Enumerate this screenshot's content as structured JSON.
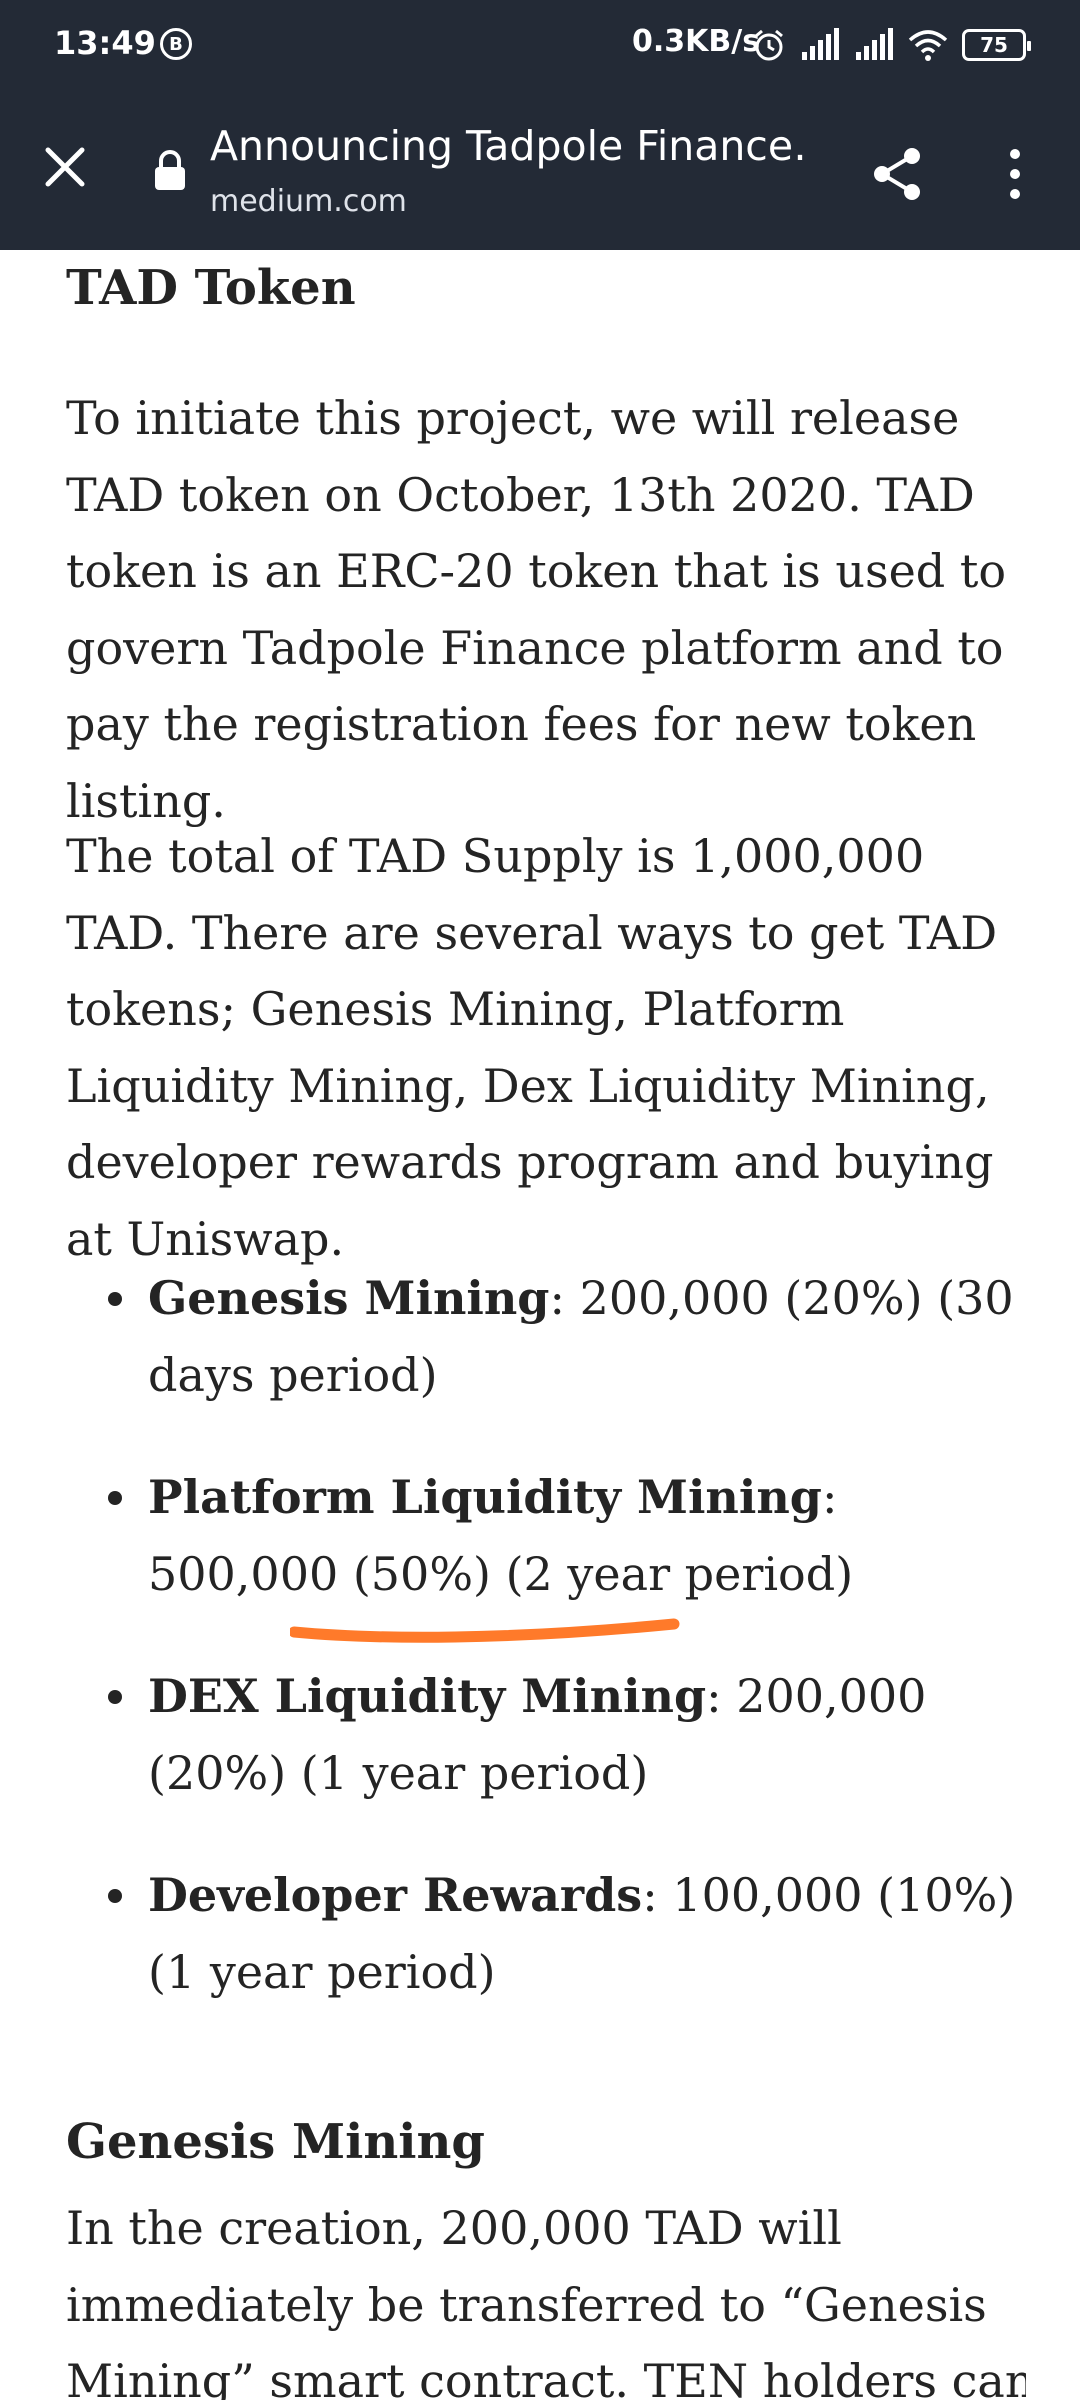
{
  "status_bar": {
    "time": "13:49",
    "b_badge": "B",
    "net_speed": "0.3KB/s",
    "battery": "75"
  },
  "toolbar": {
    "title": "Announcing Tadpole Finance…",
    "domain": "medium.com"
  },
  "article": {
    "heading_tad": "TAD Token",
    "para_intro": "To initiate this project, we will release TAD token on October, 13th 2020. TAD token is an ERC-20 token that is used to govern Tadpole Finance platform and to pay the registration fees for new token listing.",
    "para_supply": "The total of TAD Supply is 1,000,000 TAD. There are several ways to get TAD tokens; Genesis Mining, Platform Liquidity Mining, Dex Liquidity Mining, developer rewards program and buying at Uniswap.",
    "list": [
      {
        "name": "Genesis Mining",
        "detail": ": 200,000 (20%) (30 days period)"
      },
      {
        "name": "Platform Liquidity Mining",
        "detail": ": 500,000 (50%) (2 year period)"
      },
      {
        "name": "DEX Liquidity Mining",
        "detail": ": 200,000 (20%) (1 year period)"
      },
      {
        "name": "Developer Rewards",
        "detail": ": 100,000 (10%) (1 year period)"
      }
    ],
    "heading_genesis": "Genesis Mining",
    "para_genesis": "In the creation, 200,000 TAD will immediately be transferred to “Genesis Mining” smart contract. TEN holders can"
  },
  "colors": {
    "bar_bg": "#232a36",
    "text": "#242424",
    "annotation": "#ff7a2a"
  }
}
